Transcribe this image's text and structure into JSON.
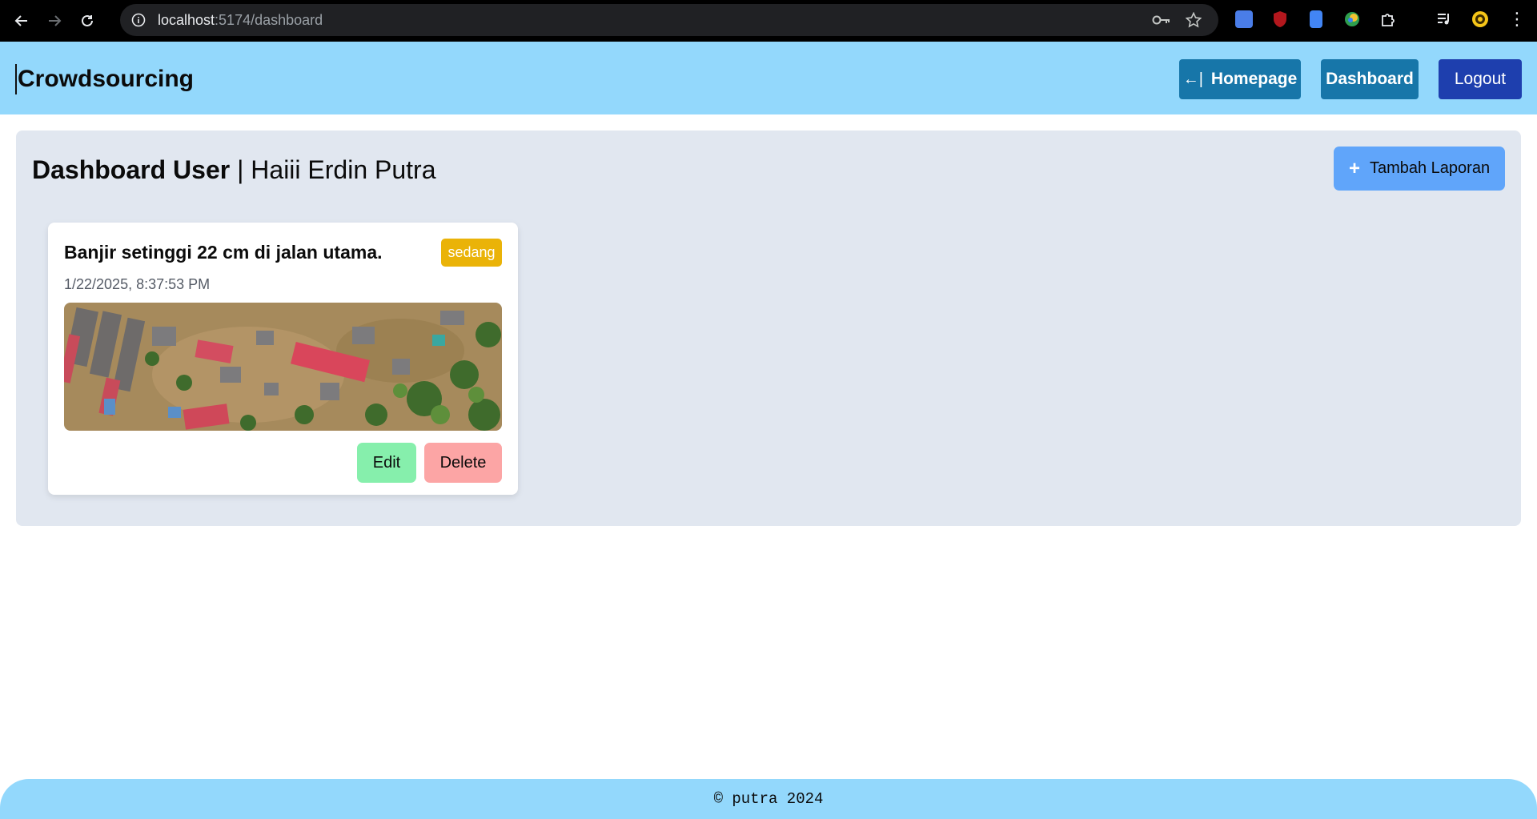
{
  "browser": {
    "url_host": "localhost",
    "url_path": ":5174/dashboard"
  },
  "header": {
    "brand": "Crowdsourcing",
    "nav": {
      "homepage_icon": "←|",
      "homepage": "Homepage",
      "dashboard": "Dashboard",
      "logout": "Logout"
    }
  },
  "main": {
    "title_strong": "Dashboard User",
    "title_separator": " | ",
    "greeting": "Haiii Erdin Putra",
    "add_button_icon": "+",
    "add_button": "Tambah Laporan",
    "reports": [
      {
        "title": "Banjir setinggi 22 cm di jalan utama.",
        "severity": "sedang",
        "timestamp": "1/22/2025, 8:37:53 PM",
        "edit_label": "Edit",
        "delete_label": "Delete"
      }
    ]
  },
  "footer": {
    "text": "© putra 2024"
  },
  "colors": {
    "header_bg": "#93d8fc",
    "nav_button": "#1776a9",
    "logout_button": "#1e3fae",
    "panel_bg": "#e1e7f0",
    "add_button": "#60a5fa",
    "badge_sedang": "#eab308",
    "edit_button": "#86efac",
    "delete_button": "#fca5a5"
  }
}
